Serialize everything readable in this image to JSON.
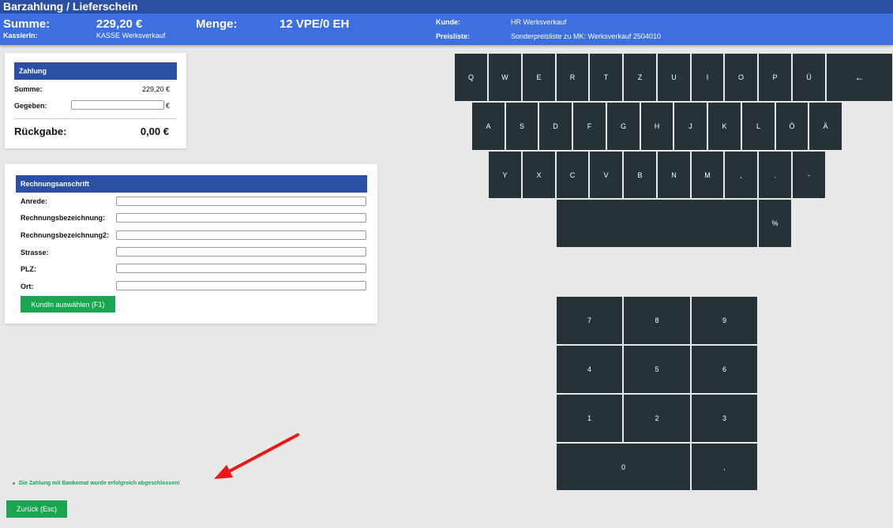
{
  "window": {
    "title": "Barzahlung / Lieferschein"
  },
  "header": {
    "summe_label": "Summe:",
    "summe_value": "229,20 €",
    "menge_label": "Menge:",
    "menge_value": "12 VPE/0 EH",
    "kassierin_label": "KassierIn:",
    "kassierin_value": "KASSE Werksverkauf",
    "kunde_label": "Kunde:",
    "kunde_value": "HR Werksverkauf",
    "preisliste_label": "Preisliste:",
    "preisliste_value": "Sonderpreisliste zu MK: Werksverkauf 2504010"
  },
  "zahlung": {
    "title": "Zahlung",
    "summe_label": "Summe:",
    "summe_value": "229,20 €",
    "gegeben_label": "Gegeben:",
    "gegeben_value": "",
    "currency": "€",
    "rueckgabe_label": "Rückgabe:",
    "rueckgabe_value": "0,00 €"
  },
  "rechnung": {
    "title": "Rechnungsanschrift",
    "fields": [
      {
        "label": "Anrede:",
        "value": ""
      },
      {
        "label": "Rechnungsbezeichnung:",
        "value": ""
      },
      {
        "label": "Rechnungsbezeichnung2:",
        "value": ""
      },
      {
        "label": "Strasse:",
        "value": ""
      },
      {
        "label": "PLZ:",
        "value": ""
      },
      {
        "label": "Ort:",
        "value": ""
      }
    ],
    "select_customer_button": "KundIn auswählen (F1)"
  },
  "keyboard": {
    "row1": [
      "Q",
      "W",
      "E",
      "R",
      "T",
      "Z",
      "U",
      "I",
      "O",
      "P",
      "Ü",
      "←"
    ],
    "row2": [
      "A",
      "S",
      "D",
      "F",
      "G",
      "H",
      "J",
      "K",
      "L",
      "Ö",
      "Ä"
    ],
    "row3": [
      "Y",
      "X",
      "C",
      "V",
      "B",
      "N",
      "M",
      ",",
      ".",
      "-"
    ],
    "row4": [
      "",
      "%"
    ]
  },
  "numpad": {
    "keys": [
      "7",
      "8",
      "9",
      "4",
      "5",
      "6",
      "1",
      "2",
      "3",
      "0",
      ","
    ]
  },
  "status": {
    "message": "Die Zahlung mit Bankomat wurde erfolgreich abgeschlossen!"
  },
  "footer": {
    "back_button": "Zurück (Esc)"
  },
  "colors": {
    "header": "#3d6fe0",
    "title": "#2a4fa3",
    "key": "#263238",
    "green": "#1aa651",
    "annotation": "#e81818"
  }
}
